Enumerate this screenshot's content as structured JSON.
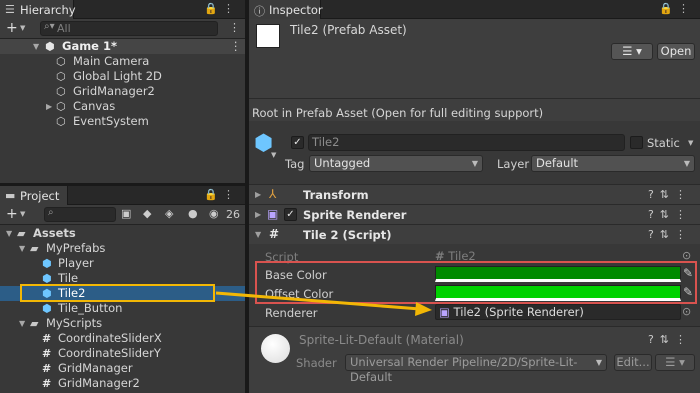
{
  "hierarchy": {
    "tab_title": "Hierarchy",
    "search_placeholder": "All",
    "items": [
      "Game 1*",
      "Main Camera",
      "Global Light 2D",
      "GridManager2",
      "Canvas",
      "EventSystem"
    ]
  },
  "project": {
    "tab_title": "Project",
    "hidden_count": "26",
    "items": [
      "Assets",
      "MyPrefabs",
      "Player",
      "Tile",
      "Tile2",
      "Tile_Button",
      "MyScripts",
      "CoordinateSliderX",
      "CoordinateSliderY",
      "GridManager",
      "GridManager2"
    ]
  },
  "inspector": {
    "tab_title": "Inspector",
    "asset_title": "Tile2 (Prefab Asset)",
    "open_label": "Open",
    "root_note": "Root in Prefab Asset (Open for full editing support)",
    "object_name": "Tile2",
    "static_label": "Static",
    "tag_label": "Tag",
    "tag_value": "Untagged",
    "layer_label": "Layer",
    "layer_value": "Default",
    "components": [
      "Transform",
      "Sprite Renderer",
      "Tile 2 (Script)"
    ],
    "script_label": "Script",
    "script_value": "Tile2",
    "base_color_label": "Base Color",
    "offset_color_label": "Offset Color",
    "renderer_label": "Renderer",
    "renderer_value": "Tile2 (Sprite Renderer)",
    "material_title": "Sprite-Lit-Default (Material)",
    "shader_label": "Shader",
    "shader_value": "Universal Render Pipeline/2D/Sprite-Lit-Default",
    "edit_label": "Edit...",
    "colors": {
      "base_color": "#008a00",
      "offset_color": "#00d200",
      "highlight_red": "#d9534f",
      "highlight_yellow": "#f2b705"
    }
  }
}
